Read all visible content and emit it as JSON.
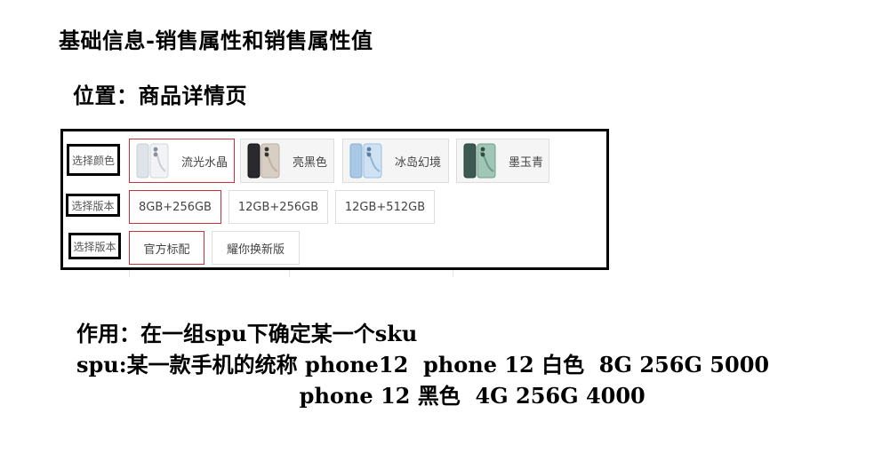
{
  "title": "基础信息-销售属性和销售属性值",
  "location": "位置：商品详情页",
  "selector": {
    "color_row": {
      "label": "选择颜色",
      "options": [
        {
          "label": "流光水晶",
          "image": "phone-thumbnail-silver",
          "selected": true
        },
        {
          "label": "亮黑色",
          "image": "phone-thumbnail-black",
          "selected": false
        },
        {
          "label": "冰岛幻境",
          "image": "phone-thumbnail-blue",
          "selected": false
        },
        {
          "label": "墨玉青",
          "image": "phone-thumbnail-green",
          "selected": false
        }
      ]
    },
    "version_row": {
      "label": "选择版本",
      "options": [
        {
          "label": "8GB+256GB",
          "selected": true
        },
        {
          "label": "12GB+256GB",
          "selected": false
        },
        {
          "label": "12GB+512GB",
          "selected": false
        }
      ]
    },
    "package_row": {
      "label": "选择版本",
      "options": [
        {
          "label": "官方标配",
          "selected": true
        },
        {
          "label": "耀你换新版",
          "selected": false
        }
      ]
    },
    "selected_border_color": "#c8323c",
    "option_border_color": "#dddddd"
  },
  "notes": {
    "line1": "作用：在一组spu下确定某一个sku",
    "line2": "spu:某一款手机的统称 phone12  phone 12 白色  8G 256G 5000",
    "line3": "                              phone 12 黑色  4G 256G 4000"
  }
}
